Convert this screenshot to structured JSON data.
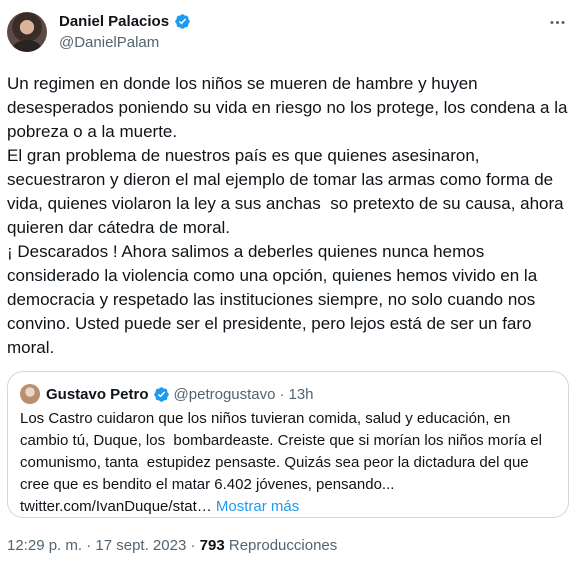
{
  "author": {
    "display_name": "Daniel Palacios",
    "handle": "@DanielPalam",
    "verified": true
  },
  "tweet": {
    "text": "Un regimen en donde los niños se mueren de hambre y huyen desesperados poniendo su vida en riesgo no los protege, los condena a la pobreza o a la muerte.\nEl gran problema de nuestros país es que quienes asesinaron, secuestraron y dieron el mal ejemplo de tomar las armas como forma de vida, quienes violaron la ley a sus anchas  so pretexto de su causa, ahora quieren dar cátedra de moral.\n¡ Descarados ! Ahora salimos a deberles quienes nunca hemos considerado la violencia como una opción, quienes hemos vivido en la democracia y respetado las instituciones siempre, no solo cuando nos convino. Usted puede ser el presidente, pero lejos está de ser un faro moral."
  },
  "quoted_tweet": {
    "display_name": "Gustavo Petro",
    "handle": "@petrogustavo",
    "separator": "·",
    "time": "13h",
    "verified": true,
    "text": "Los Castro cuidaron que los niños tuvieran comida, salud y educación, en cambio tú, Duque, los  bombardeaste. Creiste que si morían los niños moría el comunismo, tanta  estupidez pensaste. Quizás sea peor la dictadura del que cree que es bendito el matar 6.402 jóvenes, pensando...",
    "link": "twitter.com/IvanDuque/stat…",
    "show_more": "Mostrar más"
  },
  "footer": {
    "time": "12:29 p. m.",
    "separator": "·",
    "date": "17 sept. 2023",
    "views_count": "793",
    "views_label": "Reproducciones"
  },
  "colors": {
    "verified_badge": "#1d9bf0",
    "link": "#1d9bf0",
    "secondary_text": "#536471",
    "border": "#cfd9de"
  },
  "icons": {
    "verified": "verified-badge-icon",
    "more": "more-horizontal-icon"
  }
}
